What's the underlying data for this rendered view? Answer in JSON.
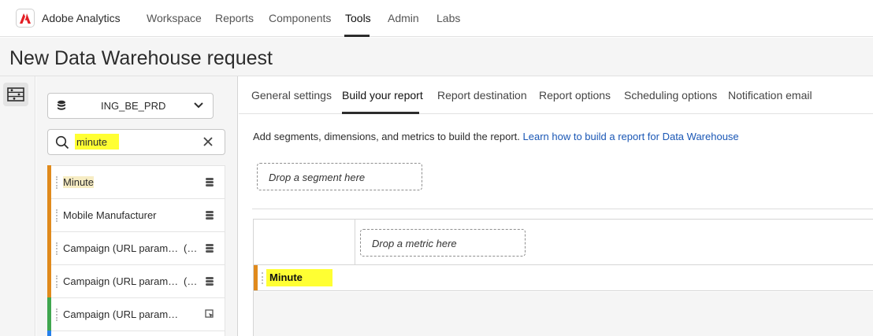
{
  "app": {
    "name": "Adobe Analytics",
    "logo_icon": "adobe-logo-icon",
    "brand_color": "#e31e24"
  },
  "nav": {
    "items": [
      {
        "label": "Workspace"
      },
      {
        "label": "Reports"
      },
      {
        "label": "Components"
      },
      {
        "label": "Tools",
        "active": true
      },
      {
        "label": "Admin"
      },
      {
        "label": "Labs"
      }
    ]
  },
  "page": {
    "title": "New Data Warehouse request"
  },
  "rail": {
    "icon": "component-panel-icon"
  },
  "panel": {
    "report_suite": "ING_BE_PRD",
    "search": {
      "value": "minute",
      "placeholder": ""
    },
    "items": [
      {
        "label": "Minute",
        "color": "#e08a1c",
        "paren": "",
        "action_icon": "dimension-stack-icon"
      },
      {
        "label": "Mobile Manufacturer",
        "color": "#e08a1c",
        "paren": "",
        "action_icon": "dimension-stack-icon"
      },
      {
        "label": "Campaign (URL param…",
        "color": "#e08a1c",
        "paren": "(…",
        "action_icon": "dimension-stack-icon"
      },
      {
        "label": "Campaign (URL param…",
        "color": "#e08a1c",
        "paren": "(…",
        "action_icon": "dimension-stack-icon"
      },
      {
        "label": "Campaign (URL param…",
        "color": "#3fa64f",
        "paren": "",
        "action_icon": "preview-icon"
      }
    ]
  },
  "tabs": {
    "items": [
      {
        "label": "General settings"
      },
      {
        "label": "Build your report",
        "active": true
      },
      {
        "label": "Report destination"
      },
      {
        "label": "Report options"
      },
      {
        "label": "Scheduling options"
      },
      {
        "label": "Notification email"
      }
    ]
  },
  "main": {
    "help_text": "Add segments, dimensions, and metrics to build the report.",
    "help_link": "Learn how to build a report for Data Warehouse",
    "segment_drop": "Drop a segment here",
    "metric_drop": "Drop a metric here",
    "dimension_row": "Minute",
    "highlight_color": "#ffff33"
  }
}
